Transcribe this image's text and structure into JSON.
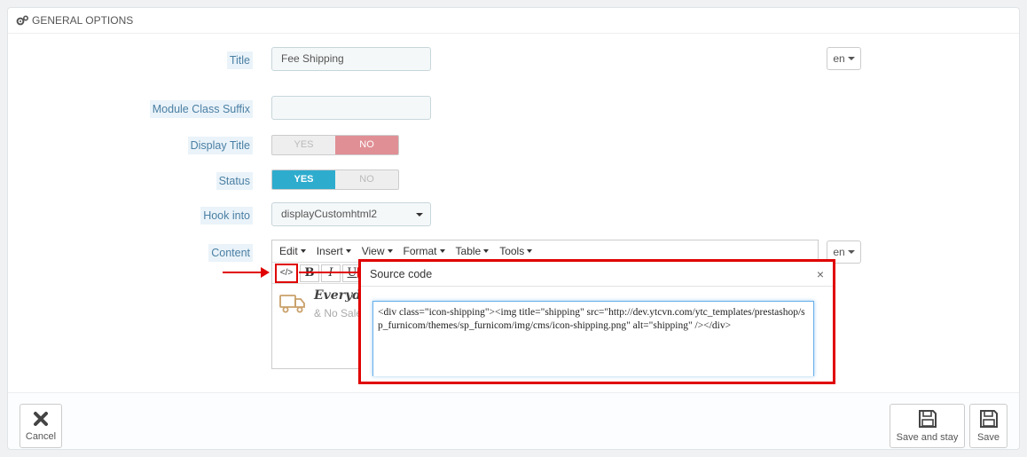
{
  "panel": {
    "title": "GENERAL OPTIONS",
    "icon": "cogs-icon"
  },
  "form": {
    "title": {
      "label": "Title",
      "value": "Fee Shipping",
      "lang": "en"
    },
    "module_class_suffix": {
      "label": "Module Class Suffix",
      "value": ""
    },
    "display_title": {
      "label": "Display Title",
      "yes": "YES",
      "no": "NO",
      "selected": "NO"
    },
    "status": {
      "label": "Status",
      "yes": "YES",
      "no": "NO",
      "selected": "YES"
    },
    "hook_into": {
      "label": "Hook into",
      "value": "displayCustomhtml2"
    },
    "content": {
      "label": "Content",
      "lang": "en"
    }
  },
  "editor": {
    "menu": [
      "Edit",
      "Insert",
      "View",
      "Format",
      "Table",
      "Tools"
    ],
    "toolbar": {
      "source_code": "</>",
      "bold": "B",
      "italic": "I",
      "underline": "U"
    },
    "preview": {
      "line1": "Everyday",
      "line2": "& No Sale"
    }
  },
  "modal": {
    "title": "Source code",
    "close": "×",
    "code": "<div class=\"icon-shipping\"><img title=\"shipping\" src=\"http://dev.ytcvn.com/ytc_templates/prestashop/sp_furnicom/themes/sp_furnicom/img/cms/icon-shipping.png\" alt=\"shipping\" /></div>"
  },
  "footer": {
    "cancel": "Cancel",
    "save_and_stay": "Save and stay",
    "save": "Save"
  },
  "colors": {
    "accent": "#2eacce",
    "no_active": "#e08f95",
    "highlight": "#e00000",
    "label": "#4a7fa4"
  }
}
